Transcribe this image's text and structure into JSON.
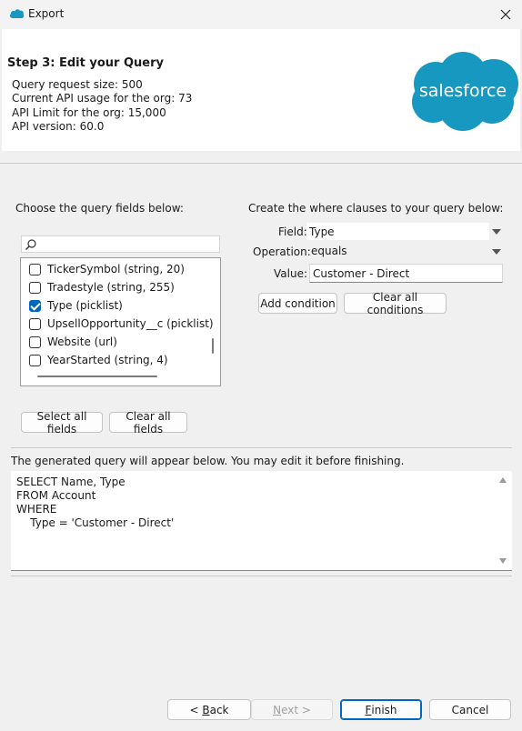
{
  "window": {
    "title": "Export"
  },
  "header": {
    "step_title": "Step 3: Edit your Query",
    "info": [
      "Query request size: 500",
      "Current API usage for the org: 73",
      "API Limit for the org: 15,000",
      "API version: 60.0"
    ],
    "logo_text": "salesforce"
  },
  "fields_panel": {
    "label": "Choose the query fields below:",
    "search_value": "",
    "items": [
      {
        "label": "TickerSymbol (string, 20)",
        "checked": false
      },
      {
        "label": "Tradestyle (string, 255)",
        "checked": false
      },
      {
        "label": "Type (picklist)",
        "checked": true
      },
      {
        "label": "UpsellOpportunity__c (picklist)",
        "checked": false
      },
      {
        "label": "Website (url)",
        "checked": false
      },
      {
        "label": "YearStarted (string, 4)",
        "checked": false
      }
    ],
    "select_all_label": "Select all fields",
    "clear_all_label": "Clear all fields"
  },
  "where_panel": {
    "label": "Create the where clauses to your query below:",
    "field_label": "Field:",
    "field_value": "Type",
    "operation_label": "Operation:",
    "operation_value": "equals",
    "value_label": "Value:",
    "value_value": "Customer - Direct",
    "add_condition_label": "Add condition",
    "clear_conditions_label": "Clear all conditions"
  },
  "query": {
    "label": "The generated query will appear below.  You may edit it before finishing.",
    "lines": [
      "SELECT Name, Type",
      "FROM Account",
      "WHERE",
      "    Type = 'Customer - Direct'"
    ]
  },
  "footer": {
    "back_prefix": "< ",
    "back_underline": "B",
    "back_rest": "ack",
    "next_underline": "N",
    "next_rest": "ext >",
    "finish_underline": "F",
    "finish_rest": "inish",
    "cancel_label": "Cancel"
  },
  "colors": {
    "brand": "#1798c1",
    "checkbox_accent": "#0067c0"
  }
}
